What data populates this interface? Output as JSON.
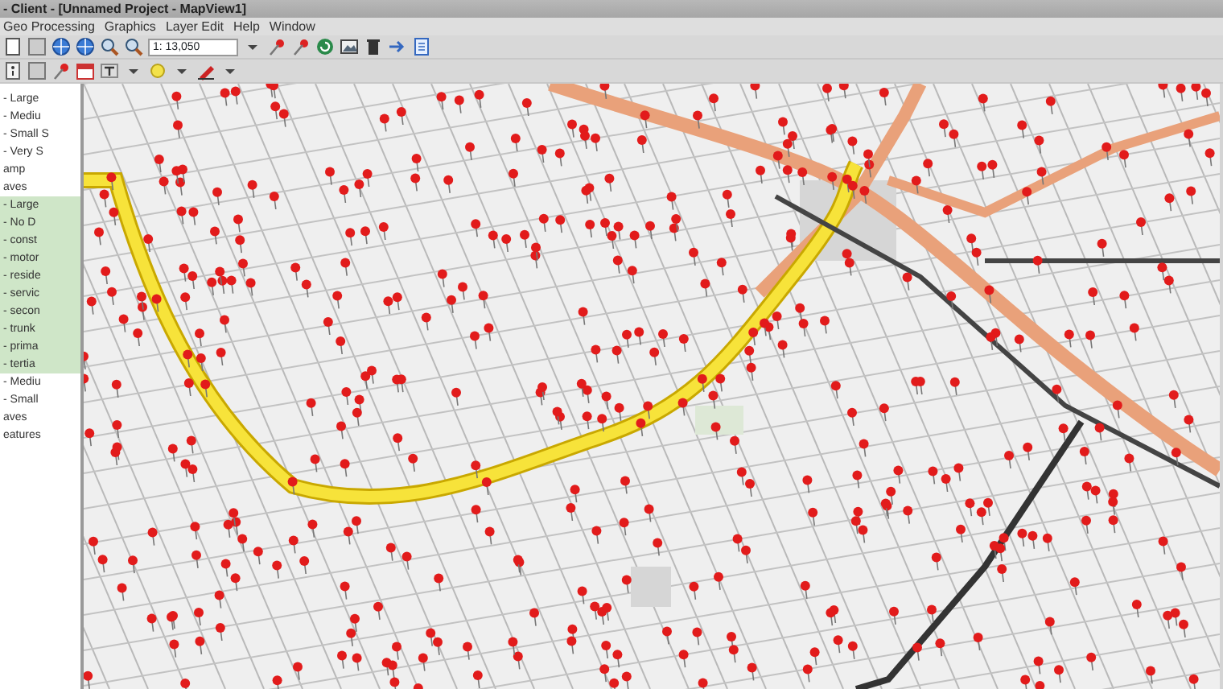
{
  "window": {
    "title": "- Client - [Unnamed Project - MapView1]"
  },
  "menu": [
    "Geo Processing",
    "Graphics",
    "Layer Edit",
    "Help",
    "Window"
  ],
  "toolbar": {
    "scale": "1: 13,050"
  },
  "layers": [
    {
      "label": "- Large",
      "highlighted": false
    },
    {
      "label": "- Mediu",
      "highlighted": false
    },
    {
      "label": "- Small S",
      "highlighted": false
    },
    {
      "label": "- Very S",
      "highlighted": false
    },
    {
      "label": "amp",
      "highlighted": false
    },
    {
      "label": "aves",
      "highlighted": false
    },
    {
      "label": "- Large",
      "highlighted": true
    },
    {
      "label": "- No D",
      "highlighted": true
    },
    {
      "label": "- const",
      "highlighted": true
    },
    {
      "label": "- motor",
      "highlighted": true
    },
    {
      "label": "- reside",
      "highlighted": true
    },
    {
      "label": "- servic",
      "highlighted": true
    },
    {
      "label": "- secon",
      "highlighted": true
    },
    {
      "label": "- trunk",
      "highlighted": true
    },
    {
      "label": "- prima",
      "highlighted": true
    },
    {
      "label": "- tertia",
      "highlighted": true
    },
    {
      "label": "- Mediu",
      "highlighted": false
    },
    {
      "label": "- Small",
      "highlighted": false
    },
    {
      "label": "aves",
      "highlighted": false
    },
    {
      "label": "eatures",
      "highlighted": false
    }
  ]
}
